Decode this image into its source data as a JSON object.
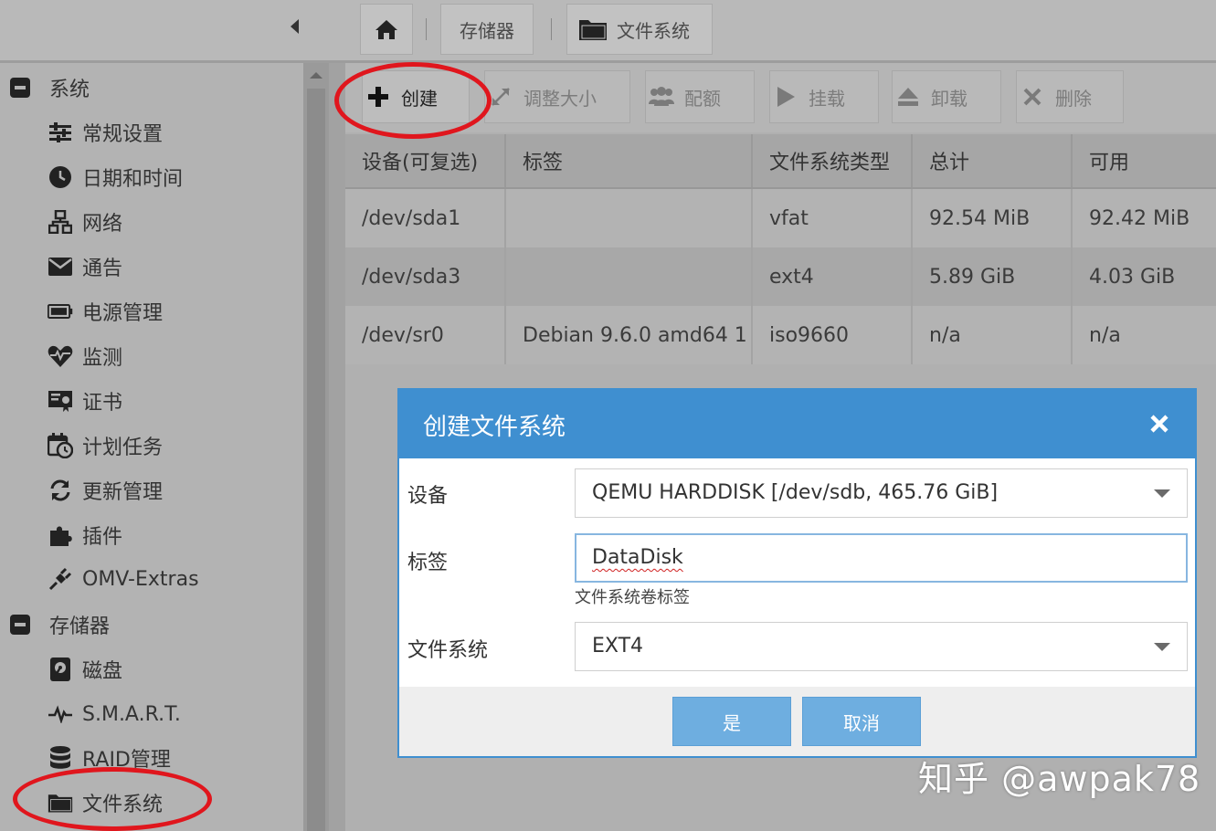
{
  "topbar": {
    "breadcrumb": [
      {
        "icon": "home-icon"
      },
      {
        "label": "存储器"
      },
      {
        "icon": "folder-icon",
        "label": "文件系统"
      }
    ]
  },
  "sidebar": {
    "groups": [
      {
        "label": "系统",
        "items": [
          {
            "icon": "sliders-icon",
            "label": "常规设置"
          },
          {
            "icon": "clock-icon",
            "label": "日期和时间"
          },
          {
            "icon": "network-icon",
            "label": "网络"
          },
          {
            "icon": "envelope-icon",
            "label": "通告"
          },
          {
            "icon": "battery-icon",
            "label": "电源管理"
          },
          {
            "icon": "heartbeat-icon",
            "label": "监测"
          },
          {
            "icon": "certificate-icon",
            "label": "证书"
          },
          {
            "icon": "calendar-clock-icon",
            "label": "计划任务"
          },
          {
            "icon": "refresh-icon",
            "label": "更新管理"
          },
          {
            "icon": "puzzle-icon",
            "label": "插件"
          },
          {
            "icon": "plug-icon",
            "label": "OMV-Extras"
          }
        ]
      },
      {
        "label": "存储器",
        "items": [
          {
            "icon": "harddisk-icon",
            "label": "磁盘"
          },
          {
            "icon": "pulse-icon",
            "label": "S.M.A.R.T."
          },
          {
            "icon": "database-icon",
            "label": "RAID管理"
          },
          {
            "icon": "folder-icon",
            "label": "文件系统"
          }
        ]
      }
    ]
  },
  "toolbar": {
    "create": "创建",
    "resize": "调整大小",
    "quota": "配额",
    "mount": "挂载",
    "unmount": "卸载",
    "delete": "删除"
  },
  "table": {
    "columns": [
      "设备(可复选)",
      "标签",
      "文件系统类型",
      "总计",
      "可用"
    ],
    "rows": [
      [
        "/dev/sda1",
        "",
        "vfat",
        "92.54 MiB",
        "92.42 MiB"
      ],
      [
        "/dev/sda3",
        "",
        "ext4",
        "5.89 GiB",
        "4.03 GiB"
      ],
      [
        "/dev/sr0",
        "Debian 9.6.0 amd64 1",
        "iso9660",
        "n/a",
        "n/a"
      ]
    ]
  },
  "dialog": {
    "title": "创建文件系统",
    "device_label": "设备",
    "device_value": "QEMU HARDDISK [/dev/sdb, 465.76 GiB]",
    "label_label": "标签",
    "label_value": "DataDisk",
    "label_hint": "文件系统卷标签",
    "fs_label": "文件系统",
    "fs_value": "EXT4",
    "ok": "是",
    "cancel": "取消"
  },
  "watermark": "知乎 @awpak78",
  "colors": {
    "dialog_accent": "#3f8fd0",
    "button": "#6eaee0",
    "annotation": "#e0161d"
  }
}
